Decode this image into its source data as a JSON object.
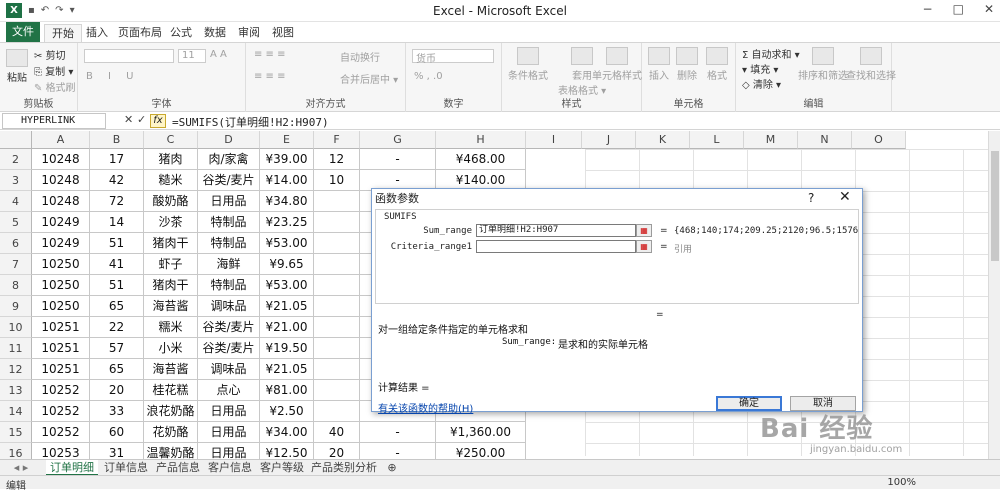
{
  "window": {
    "title": "Excel - Microsoft Excel",
    "controls": [
      "−",
      "□",
      "✕"
    ]
  },
  "qat": {
    "logo": "X"
  },
  "tabs": [
    {
      "label": "文件"
    },
    {
      "label": "开始"
    },
    {
      "label": "插入"
    },
    {
      "label": "页面布局"
    },
    {
      "label": "公式"
    },
    {
      "label": "数据"
    },
    {
      "label": "审阅"
    },
    {
      "label": "视图"
    }
  ],
  "ribbon": {
    "clipboard": {
      "paste": "粘贴",
      "cut": "剪切",
      "copy": "复制 ▾",
      "format_painter": "格式刷",
      "label": "剪贴板"
    },
    "font": {
      "size": "11",
      "label": "字体"
    },
    "alignment": {
      "wrap": "自动换行",
      "merge": "合并后居中 ▾",
      "label": "对齐方式"
    },
    "number": {
      "format": "货币",
      "label": "数字"
    },
    "styles": {
      "cond": "条件格式",
      "table": "套用",
      "table2": "表格格式 ▾",
      "cell": "单元格样式",
      "label": "样式"
    },
    "cells": {
      "insert": "插入",
      "delete": "删除",
      "format": "格式",
      "label": "单元格"
    },
    "editing": {
      "autosum": "Σ 自动求和 ▾",
      "fill": "填充 ▾",
      "clear": "清除 ▾",
      "sort": "排序和筛选",
      "find": "查找和选择",
      "label": "编辑"
    }
  },
  "formula_bar": {
    "name_box": "HYPERLINK",
    "cancel": "✕",
    "enter": "✓",
    "fx": "fx",
    "formula": "=SUMIFS(订单明细!H2:H907)"
  },
  "columns": [
    "A",
    "B",
    "C",
    "D",
    "E",
    "F",
    "G",
    "H",
    "I",
    "J",
    "K",
    "L",
    "M",
    "N",
    "O"
  ],
  "rows": [
    {
      "n": "2",
      "a": "10248",
      "b": "17",
      "c": "猪肉",
      "d": "肉/家禽",
      "e": "¥39.00",
      "f": "12",
      "g": "-",
      "h": "¥468.00"
    },
    {
      "n": "3",
      "a": "10248",
      "b": "42",
      "c": "糙米",
      "d": "谷类/麦片",
      "e": "¥14.00",
      "f": "10",
      "g": "-",
      "h": "¥140.00"
    },
    {
      "n": "4",
      "a": "10248",
      "b": "72",
      "c": "酸奶酪",
      "d": "日用品",
      "e": "¥34.80",
      "f": "",
      "g": "",
      "h": ""
    },
    {
      "n": "5",
      "a": "10249",
      "b": "14",
      "c": "沙茶",
      "d": "特制品",
      "e": "¥23.25",
      "f": "",
      "g": "",
      "h": ""
    },
    {
      "n": "6",
      "a": "10249",
      "b": "51",
      "c": "猪肉干",
      "d": "特制品",
      "e": "¥53.00",
      "f": "",
      "g": "",
      "h": ""
    },
    {
      "n": "7",
      "a": "10250",
      "b": "41",
      "c": "虾子",
      "d": "海鲜",
      "e": "¥9.65",
      "f": "",
      "g": "",
      "h": ""
    },
    {
      "n": "8",
      "a": "10250",
      "b": "51",
      "c": "猪肉干",
      "d": "特制品",
      "e": "¥53.00",
      "f": "",
      "g": "",
      "h": ""
    },
    {
      "n": "9",
      "a": "10250",
      "b": "65",
      "c": "海苔酱",
      "d": "调味品",
      "e": "¥21.05",
      "f": "",
      "g": "",
      "h": ""
    },
    {
      "n": "10",
      "a": "10251",
      "b": "22",
      "c": "糯米",
      "d": "谷类/麦片",
      "e": "¥21.00",
      "f": "",
      "g": "",
      "h": ""
    },
    {
      "n": "11",
      "a": "10251",
      "b": "57",
      "c": "小米",
      "d": "谷类/麦片",
      "e": "¥19.50",
      "f": "",
      "g": "",
      "h": ""
    },
    {
      "n": "12",
      "a": "10251",
      "b": "65",
      "c": "海苔酱",
      "d": "调味品",
      "e": "¥21.05",
      "f": "",
      "g": "",
      "h": ""
    },
    {
      "n": "13",
      "a": "10252",
      "b": "20",
      "c": "桂花糕",
      "d": "点心",
      "e": "¥81.00",
      "f": "",
      "g": "",
      "h": ""
    },
    {
      "n": "14",
      "a": "10252",
      "b": "33",
      "c": "浪花奶酪",
      "d": "日用品",
      "e": "¥2.50",
      "f": "",
      "g": "",
      "h": ""
    },
    {
      "n": "15",
      "a": "10252",
      "b": "60",
      "c": "花奶酪",
      "d": "日用品",
      "e": "¥34.00",
      "f": "40",
      "g": "-",
      "h": "¥1,360.00"
    },
    {
      "n": "16",
      "a": "10253",
      "b": "31",
      "c": "温馨奶酪",
      "d": "日用品",
      "e": "¥12.50",
      "f": "20",
      "g": "-",
      "h": "¥250.00"
    }
  ],
  "sheets": [
    {
      "label": "订单明细"
    },
    {
      "label": "订单信息"
    },
    {
      "label": "产品信息"
    },
    {
      "label": "客户信息"
    },
    {
      "label": "客户等级"
    },
    {
      "label": "产品类别分析"
    }
  ],
  "status": {
    "mode": "编辑",
    "zoom": "100%"
  },
  "dialog": {
    "title": "函数参数",
    "help": "?",
    "close": "✕",
    "function_name": "SUMIFS",
    "param1_label": "Sum_range",
    "param1_value": "订单明细!H2:H907",
    "param1_result": "{468;140;174;209.25;2120;96.5;1576",
    "param2_label": "Criteria_range1",
    "param2_value": "",
    "param2_result": "引用",
    "eq": "=",
    "description": "对一组给定条件指定的单元格求和",
    "param_desc_name": "Sum_range:",
    "param_desc_text": "是求和的实际单元格",
    "result_label": "计算结果 =",
    "help_link": "有关该函数的帮助(H)",
    "ok": "确定",
    "cancel": "取消"
  },
  "watermark": {
    "text": "Bai 经验",
    "url": "jingyan.baidu.com"
  }
}
